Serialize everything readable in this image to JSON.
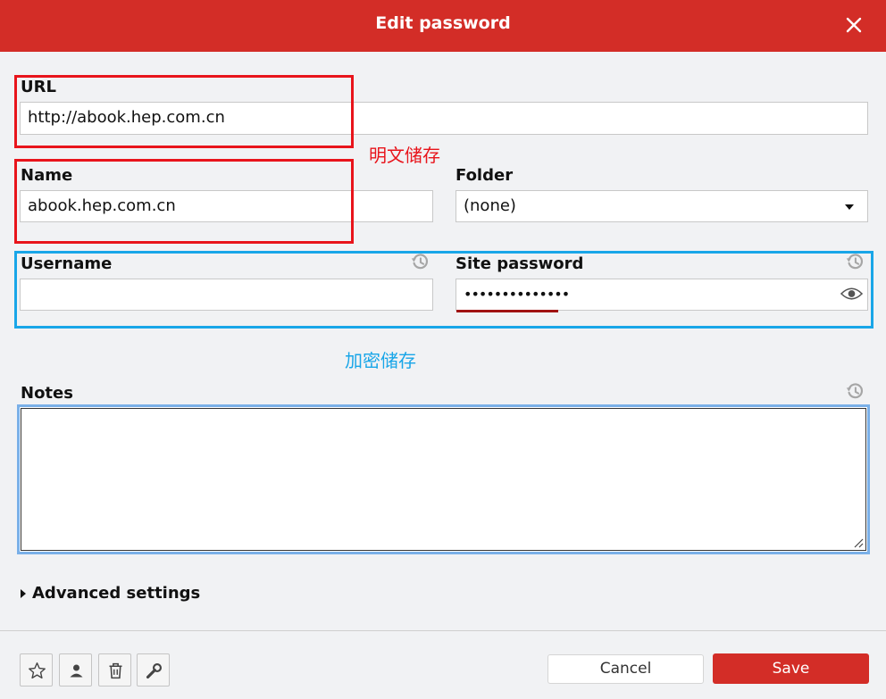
{
  "dialog": {
    "title": "Edit password"
  },
  "url": {
    "label": "URL",
    "value": "http://abook.hep.com.cn"
  },
  "name": {
    "label": "Name",
    "value": "abook.hep.com.cn"
  },
  "folder": {
    "label": "Folder",
    "value": "(none)"
  },
  "username": {
    "label": "Username",
    "value": ""
  },
  "site_password": {
    "label": "Site password",
    "masked_value": "••••••••••••••"
  },
  "notes": {
    "label": "Notes",
    "value": ""
  },
  "advanced": {
    "label": "Advanced settings"
  },
  "annotations": {
    "plaintext_storage": "明文储存",
    "encrypted_storage": "加密储存"
  },
  "footer": {
    "cancel_label": "Cancel",
    "save_label": "Save"
  },
  "colors": {
    "brand": "#d32d27",
    "annotation_red": "#e8141b",
    "annotation_blue": "#19a6e8"
  },
  "icons": [
    "close-icon",
    "history-icon",
    "caret-down-icon",
    "eye-icon",
    "caret-right-icon",
    "star-icon",
    "share-user-icon",
    "trash-icon",
    "wrench-icon",
    "resize-grip-icon"
  ]
}
